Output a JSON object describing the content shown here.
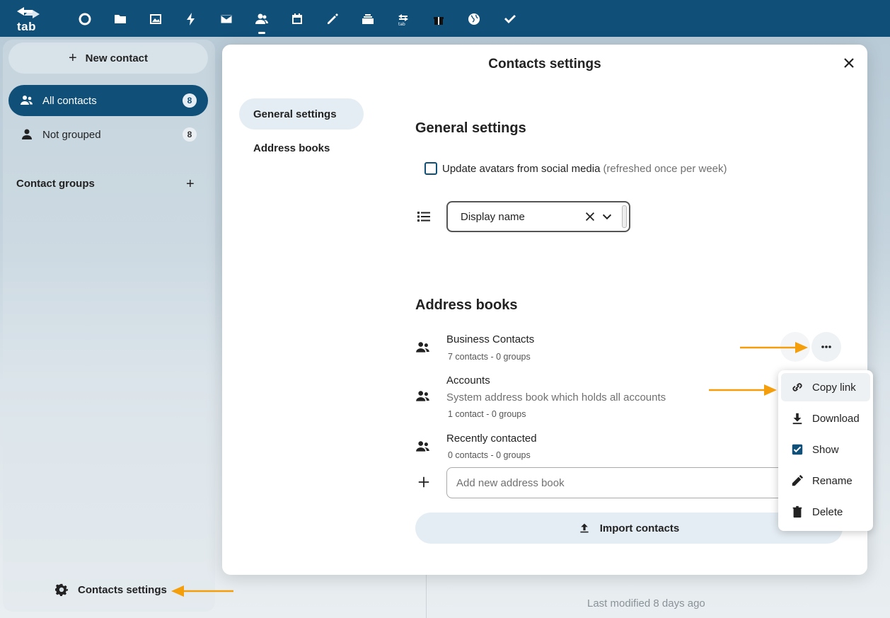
{
  "app": {
    "logo_text": "tab",
    "apps": [
      "dashboard-icon",
      "files-icon",
      "photos-icon",
      "activity-icon",
      "mail-icon",
      "contacts-icon",
      "calendar-icon",
      "notes-icon",
      "deck-icon",
      "tab-icon",
      "gift-icon",
      "globe-icon",
      "tasks-icon"
    ]
  },
  "sidebar": {
    "new_contact": "New contact",
    "items": [
      {
        "label": "All contacts",
        "count": "8"
      },
      {
        "label": "Not grouped",
        "count": "8"
      }
    ],
    "groups_title": "Contact groups",
    "settings_label": "Contacts settings"
  },
  "background": {
    "last_modified": "Last modified 8 days ago"
  },
  "dialog": {
    "title": "Contacts settings",
    "tabs": [
      "General settings",
      "Address books"
    ],
    "general": {
      "heading": "General settings",
      "checkbox_label": "Update avatars from social media",
      "checkbox_hint": "(refreshed once per week)",
      "checkbox_checked": false,
      "sort_value": "Display name"
    },
    "addressbooks": {
      "heading": "Address books",
      "items": [
        {
          "name": "Business Contacts",
          "desc": "",
          "meta": "7 contacts  - 0 groups"
        },
        {
          "name": "Accounts",
          "desc": "System address book which holds all accounts",
          "meta": "1 contact  - 0 groups"
        },
        {
          "name": "Recently contacted",
          "desc": "",
          "meta": "0 contacts  - 0 groups"
        }
      ],
      "add_placeholder": "Add new address book",
      "import_label": "Import contacts"
    }
  },
  "menu": {
    "items": [
      {
        "label": "Copy link",
        "icon": "link-icon"
      },
      {
        "label": "Download",
        "icon": "download-icon"
      },
      {
        "label": "Show",
        "icon": "checkbox-checked-icon"
      },
      {
        "label": "Rename",
        "icon": "pencil-icon"
      },
      {
        "label": "Delete",
        "icon": "trash-icon"
      }
    ]
  },
  "colors": {
    "primary": "#0f4f78",
    "annotation_arrow": "#f59e0b"
  }
}
